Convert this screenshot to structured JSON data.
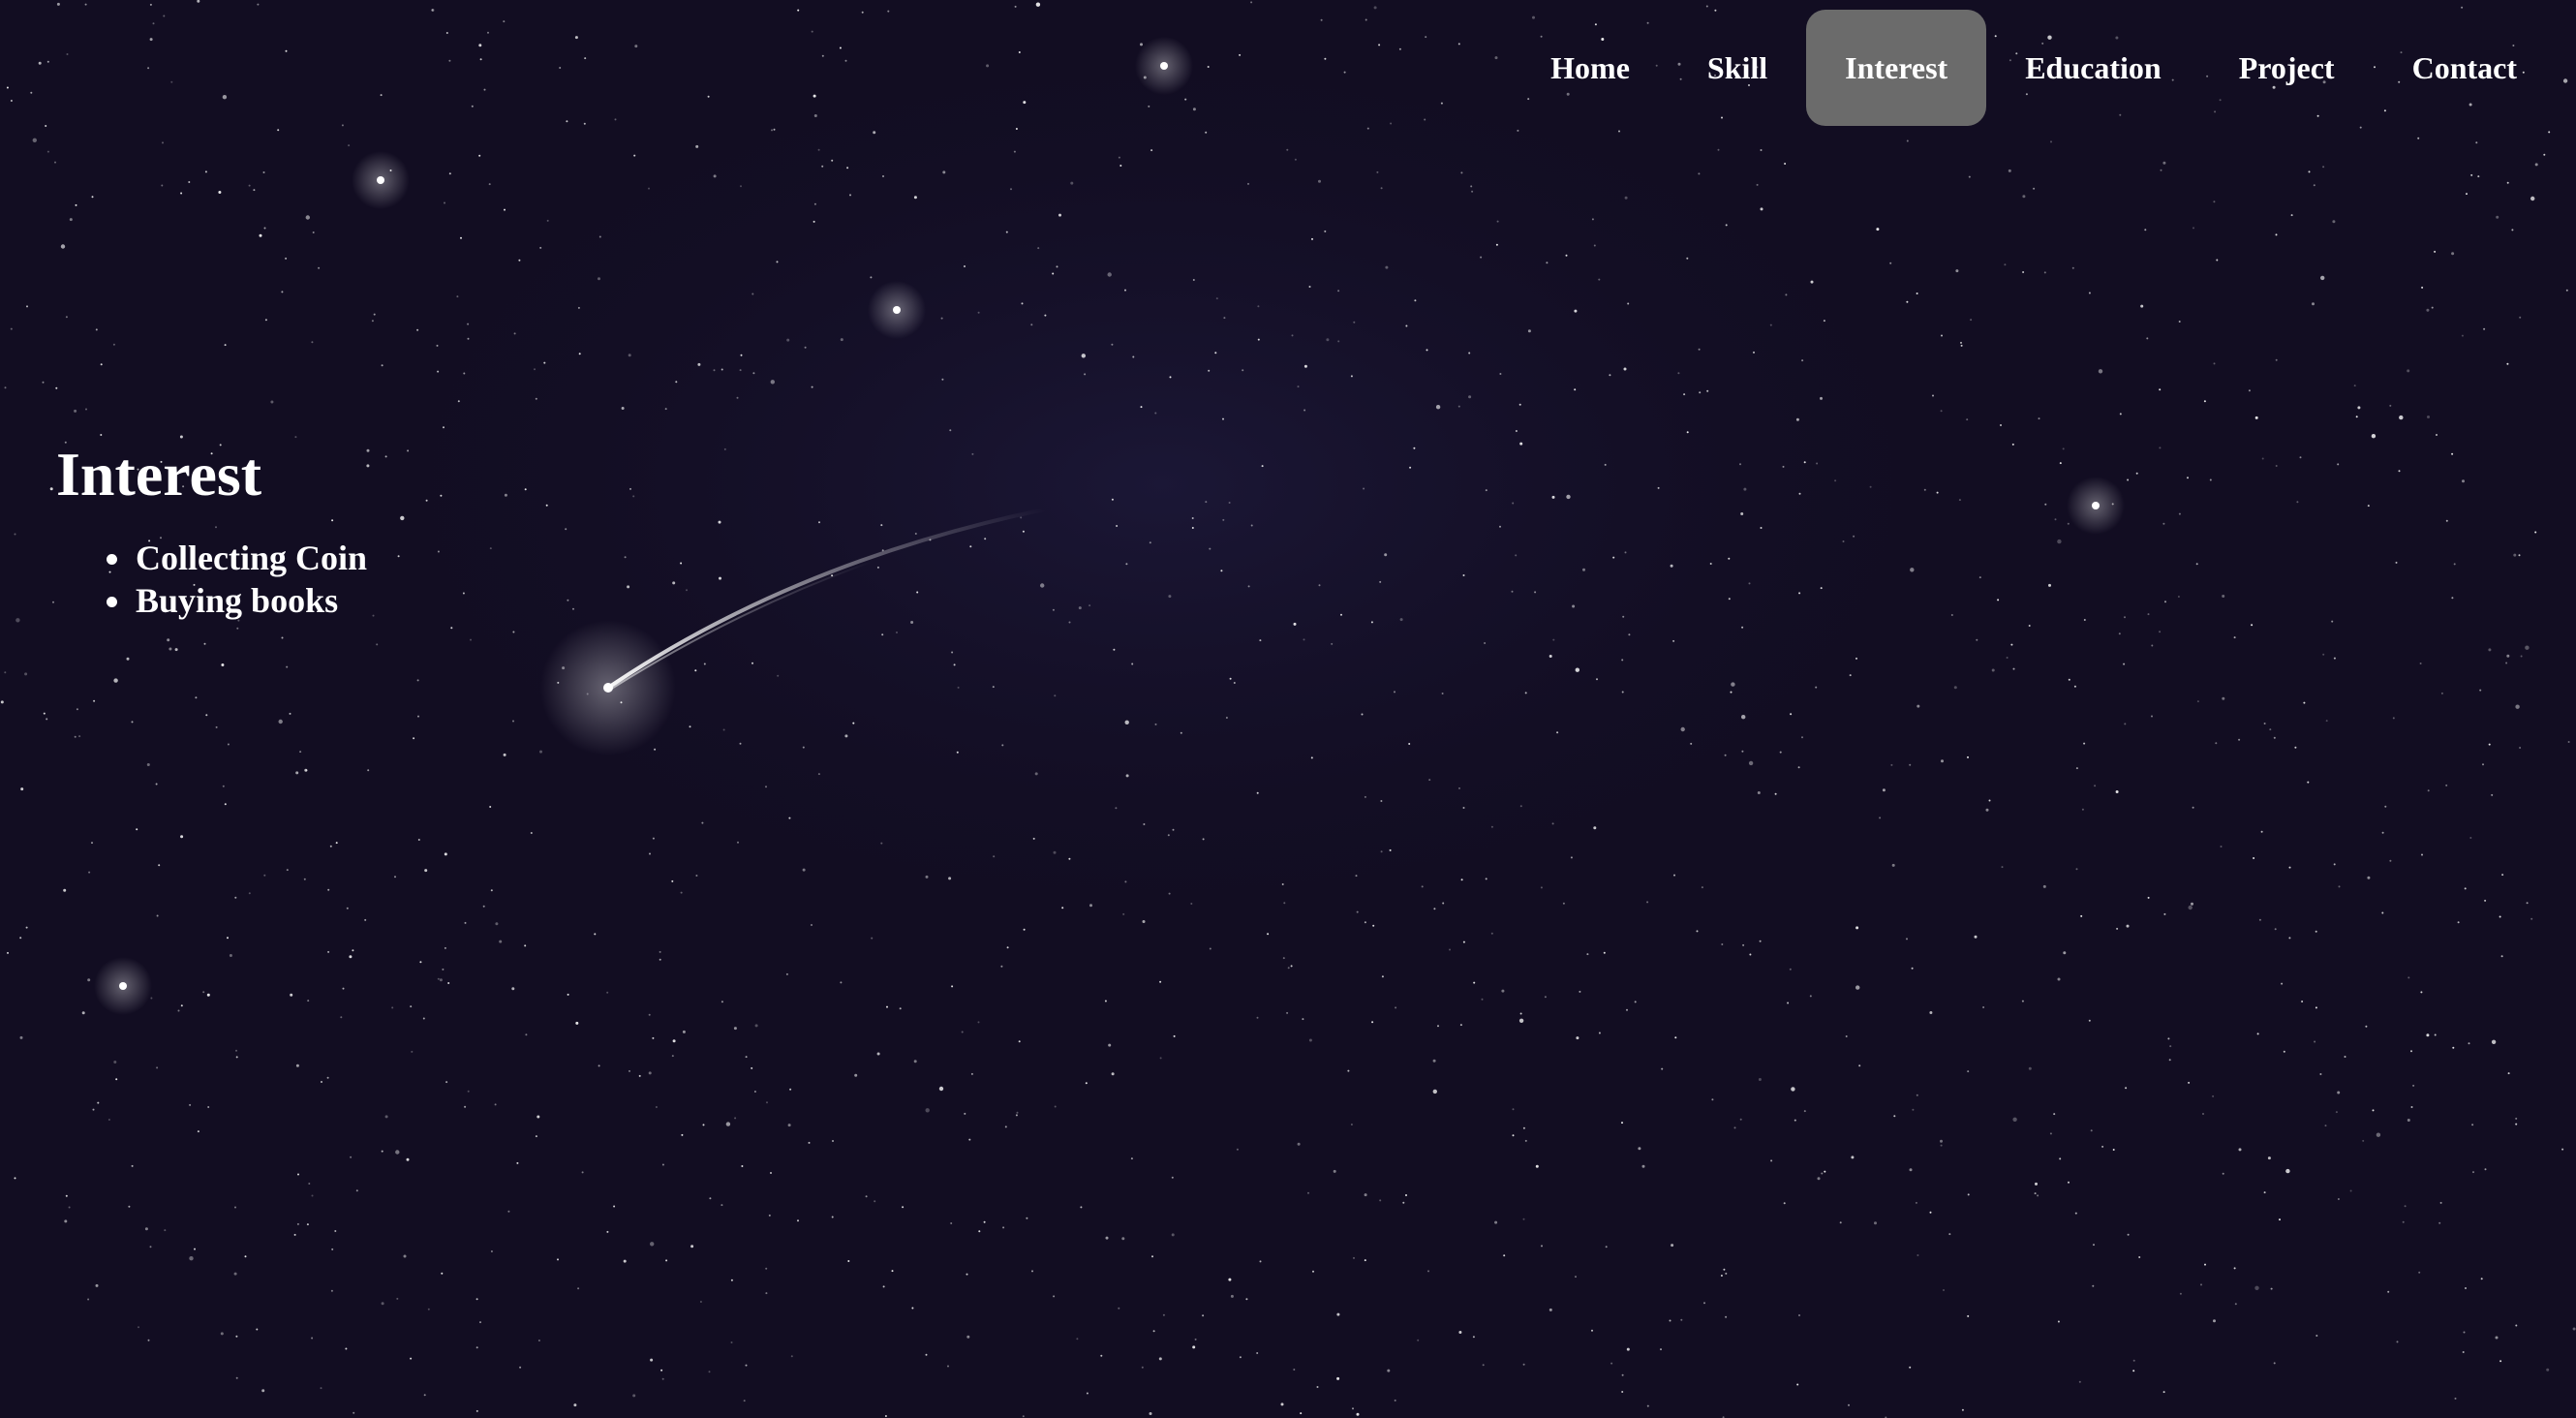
{
  "nav": {
    "items": [
      {
        "label": "Home",
        "active": false
      },
      {
        "label": "Skill",
        "active": false
      },
      {
        "label": "Interest",
        "active": true
      },
      {
        "label": "Education",
        "active": false
      },
      {
        "label": "Project",
        "active": false
      },
      {
        "label": "Contact",
        "active": false
      }
    ],
    "active_color": "#6b6b6b"
  },
  "section": {
    "title": "Interest",
    "items": [
      "Collecting Coin",
      "Buying books"
    ]
  },
  "background": {
    "base_color": "#120d22",
    "description_icon": "starry-sky-shooting-star-image"
  }
}
